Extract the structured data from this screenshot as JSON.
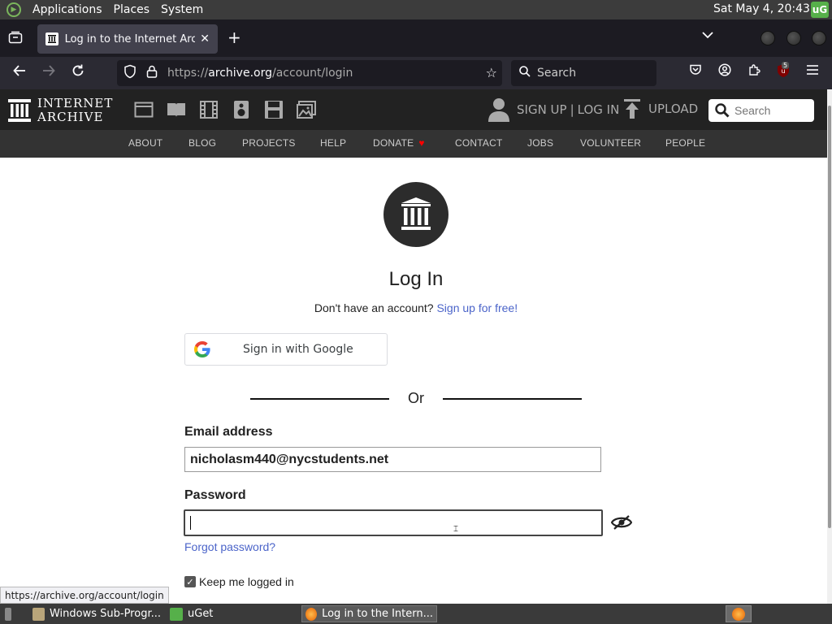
{
  "os_panel": {
    "menu": [
      "Applications",
      "Places",
      "System"
    ],
    "clock": "Sat May  4, 20:43",
    "tray_label": "uG"
  },
  "browser": {
    "tab_title": "Log in to the Internet Archive",
    "url_host": "archive.org",
    "url_scheme": "https://",
    "url_path": "/account/login",
    "search_placeholder": "Search",
    "extension_badge": "5"
  },
  "ia_header": {
    "logo_line1": "INTERNET",
    "logo_line2": "ARCHIVE",
    "signup": "SIGN UP",
    "separator": "|",
    "login": "LOG IN",
    "upload": "UPLOAD",
    "search_placeholder": "Search"
  },
  "ia_subnav": [
    "ABOUT",
    "BLOG",
    "PROJECTS",
    "HELP",
    "DONATE",
    "CONTACT",
    "JOBS",
    "VOLUNTEER",
    "PEOPLE"
  ],
  "login": {
    "title": "Log In",
    "no_account": "Don't have an account?",
    "signup_link": "Sign up for free!",
    "google_button": "Sign in with Google",
    "or": "Or",
    "email_label": "Email address",
    "email_value": "nicholasm440@nycstudents.net",
    "password_label": "Password",
    "password_value": "",
    "forgot": "Forgot password?",
    "keep_logged_in": "Keep me logged in",
    "keep_checked": true
  },
  "status_url": "https://archive.org/account/login",
  "taskbar": {
    "tasks": [
      "Windows Sub-Progr...",
      "uGet",
      "Log in to the Intern..."
    ]
  },
  "colors": {
    "ia_header_bg": "#222222",
    "link_blue": "#4b64c9",
    "donate_heart": "#ff0000"
  }
}
